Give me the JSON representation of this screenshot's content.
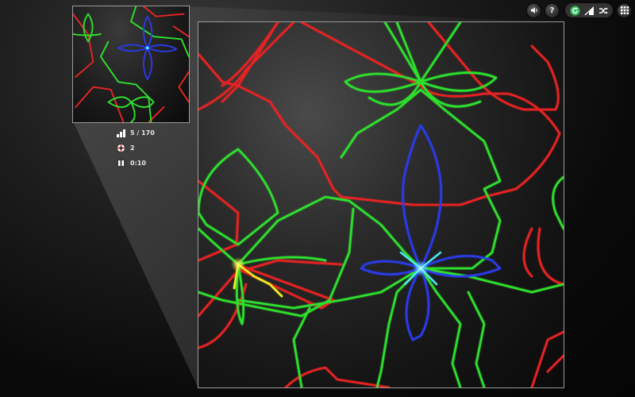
{
  "stats": {
    "level": "5 / 170",
    "hints": "2",
    "time": "0:10"
  },
  "toolbar": {
    "sound_icon": "speaker-icon",
    "help_label": "?",
    "restart_icon": "refresh-icon",
    "levels_icon": "bars-icon",
    "shuffle_icon": "shuffle-icon",
    "menu_icon": "grid-icon"
  },
  "colors": {
    "red": "#e82424",
    "green": "#2ee02e",
    "blue": "#2a3ae8",
    "cyan": "#4ff0ff",
    "yellow": "#f0f020",
    "accent": "#36c060"
  }
}
